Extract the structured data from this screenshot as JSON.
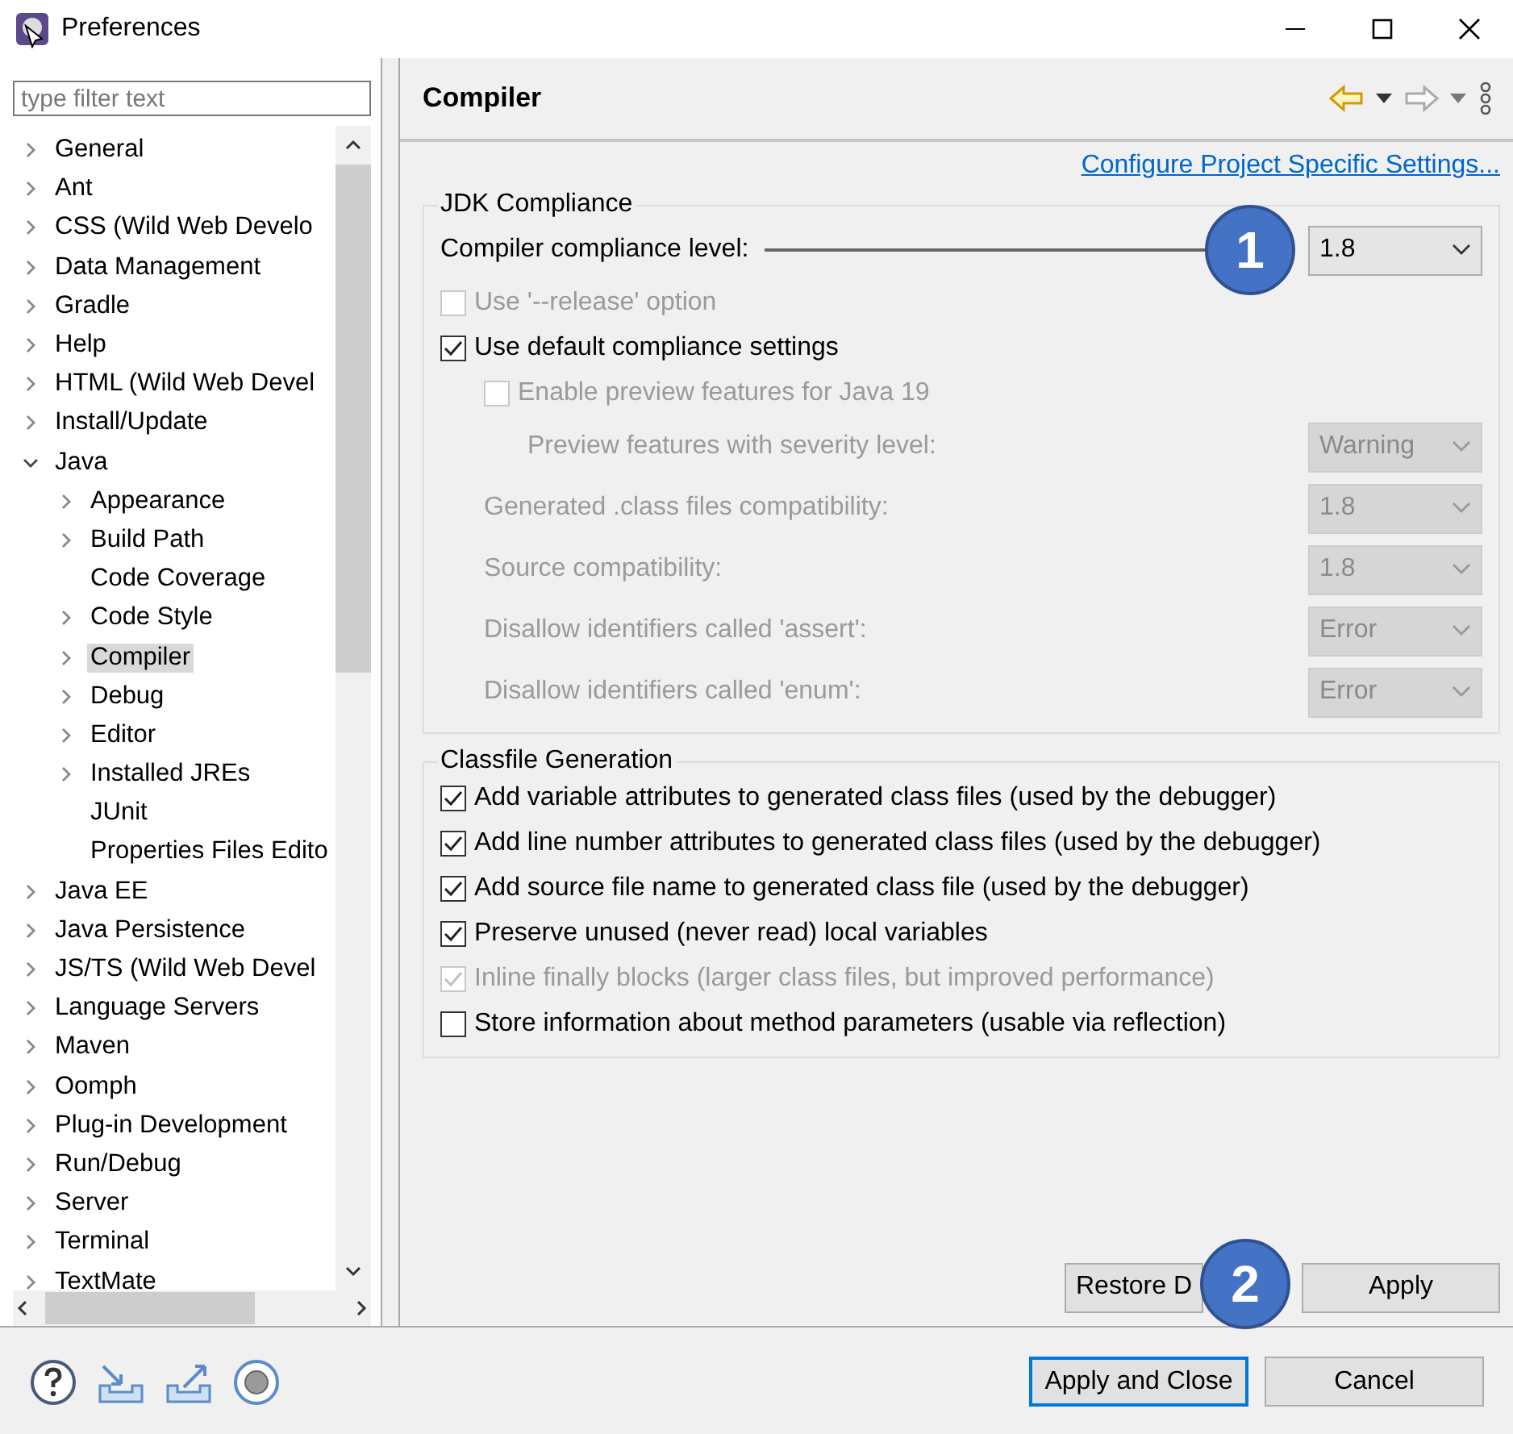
{
  "window": {
    "title": "Preferences"
  },
  "filter": {
    "placeholder": "type filter text"
  },
  "tree": [
    {
      "label": "General",
      "expandable": true,
      "expanded": false,
      "selected": false
    },
    {
      "label": "Ant",
      "expandable": true,
      "expanded": false,
      "selected": false
    },
    {
      "label": "CSS (Wild Web Develo",
      "expandable": true,
      "expanded": false,
      "selected": false
    },
    {
      "label": "Data Management",
      "expandable": true,
      "expanded": false,
      "selected": false
    },
    {
      "label": "Gradle",
      "expandable": true,
      "expanded": false,
      "selected": false
    },
    {
      "label": "Help",
      "expandable": true,
      "expanded": false,
      "selected": false
    },
    {
      "label": "HTML (Wild Web Devel",
      "expandable": true,
      "expanded": false,
      "selected": false
    },
    {
      "label": "Install/Update",
      "expandable": true,
      "expanded": false,
      "selected": false
    },
    {
      "label": "Java",
      "expandable": true,
      "expanded": true,
      "selected": false,
      "children": [
        {
          "label": "Appearance",
          "expandable": true,
          "expanded": false,
          "selected": false
        },
        {
          "label": "Build Path",
          "expandable": true,
          "expanded": false,
          "selected": false
        },
        {
          "label": "Code Coverage",
          "expandable": false,
          "selected": false
        },
        {
          "label": "Code Style",
          "expandable": true,
          "expanded": false,
          "selected": false
        },
        {
          "label": "Compiler",
          "expandable": true,
          "expanded": false,
          "selected": true
        },
        {
          "label": "Debug",
          "expandable": true,
          "expanded": false,
          "selected": false
        },
        {
          "label": "Editor",
          "expandable": true,
          "expanded": false,
          "selected": false
        },
        {
          "label": "Installed JREs",
          "expandable": true,
          "expanded": false,
          "selected": false
        },
        {
          "label": "JUnit",
          "expandable": false,
          "selected": false
        },
        {
          "label": "Properties Files Edito",
          "expandable": false,
          "selected": false
        }
      ]
    },
    {
      "label": "Java EE",
      "expandable": true,
      "expanded": false,
      "selected": false
    },
    {
      "label": "Java Persistence",
      "expandable": true,
      "expanded": false,
      "selected": false
    },
    {
      "label": "JS/TS (Wild Web Devel",
      "expandable": true,
      "expanded": false,
      "selected": false
    },
    {
      "label": "Language Servers",
      "expandable": true,
      "expanded": false,
      "selected": false
    },
    {
      "label": "Maven",
      "expandable": true,
      "expanded": false,
      "selected": false
    },
    {
      "label": "Oomph",
      "expandable": true,
      "expanded": false,
      "selected": false
    },
    {
      "label": "Plug-in Development",
      "expandable": true,
      "expanded": false,
      "selected": false
    },
    {
      "label": "Run/Debug",
      "expandable": true,
      "expanded": false,
      "selected": false
    },
    {
      "label": "Server",
      "expandable": true,
      "expanded": false,
      "selected": false
    },
    {
      "label": "Terminal",
      "expandable": true,
      "expanded": false,
      "selected": false
    },
    {
      "label": "TextMate",
      "expandable": true,
      "expanded": false,
      "selected": false
    }
  ],
  "page": {
    "title": "Compiler",
    "link": "Configure Project Specific Settings...",
    "jdk": {
      "title": "JDK Compliance",
      "rows": [
        {
          "kind": "combo",
          "label": "Compiler compliance level:",
          "value": "1.8",
          "disabled": false,
          "callout": "1"
        },
        {
          "kind": "checkbox",
          "label": "Use '--release' option",
          "checked": false,
          "disabled": true
        },
        {
          "kind": "checkbox",
          "label": "Use default compliance settings",
          "checked": true,
          "disabled": false,
          "children": [
            {
              "kind": "checkbox",
              "label": "Enable preview features for Java 19",
              "checked": false,
              "disabled": true,
              "children": [
                {
                  "kind": "combo",
                  "label": "Preview features with severity level:",
                  "value": "Warning",
                  "disabled": true
                }
              ]
            },
            {
              "kind": "combo",
              "label": "Generated .class files compatibility:",
              "value": "1.8",
              "disabled": true
            },
            {
              "kind": "combo",
              "label": "Source compatibility:",
              "value": "1.8",
              "disabled": true
            },
            {
              "kind": "combo",
              "label": "Disallow identifiers called 'assert':",
              "value": "Error",
              "disabled": true
            },
            {
              "kind": "combo",
              "label": "Disallow identifiers called 'enum':",
              "value": "Error",
              "disabled": true
            }
          ]
        }
      ]
    },
    "classfile": {
      "title": "Classfile Generation",
      "rows": [
        {
          "kind": "checkbox",
          "label": "Add variable attributes to generated class files (used by the debugger)",
          "checked": true,
          "disabled": false
        },
        {
          "kind": "checkbox",
          "label": "Add line number attributes to generated class files (used by the debugger)",
          "checked": true,
          "disabled": false
        },
        {
          "kind": "checkbox",
          "label": "Add source file name to generated class file (used by the debugger)",
          "checked": true,
          "disabled": false
        },
        {
          "kind": "checkbox",
          "label": "Preserve unused (never read) local variables",
          "checked": true,
          "disabled": false
        },
        {
          "kind": "checkbox",
          "label": "Inline finally blocks (larger class files, but improved performance)",
          "checked": true,
          "disabled": true
        },
        {
          "kind": "checkbox",
          "label": "Store information about method parameters (usable via reflection)",
          "checked": false,
          "disabled": false
        }
      ]
    },
    "buttons": [
      {
        "label": "Restore D",
        "callout": "2"
      },
      {
        "label": "Apply"
      }
    ]
  },
  "footer": {
    "buttons": [
      {
        "label": "Apply and Close",
        "default": true
      },
      {
        "label": "Cancel",
        "default": false
      }
    ]
  }
}
